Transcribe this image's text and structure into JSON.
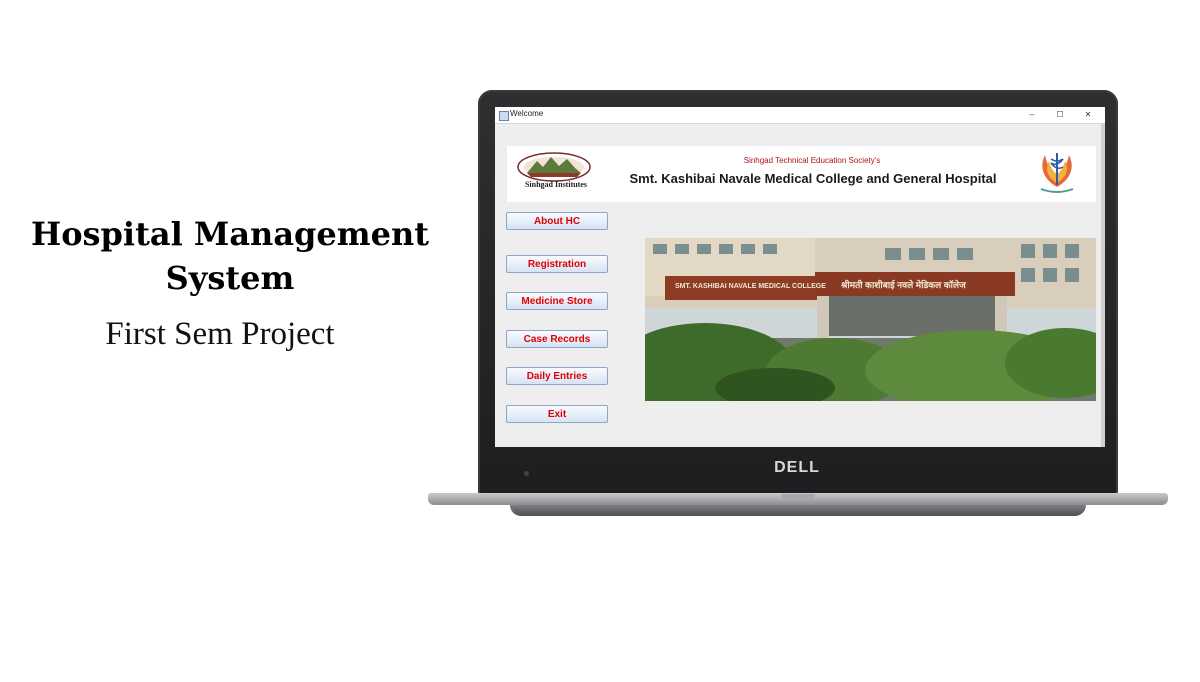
{
  "slide": {
    "title_line1": "Hospital Management",
    "title_line2": "System",
    "subtitle": "First Sem Project"
  },
  "laptop": {
    "brand": "DELL"
  },
  "window": {
    "title": "Welcome",
    "controls": {
      "minimize": "–",
      "maximize": "☐",
      "close": "✕"
    }
  },
  "banner": {
    "institute_name": "Sinhgad Institutes",
    "society": "Sinhgad Technical Education Society's",
    "college": "Smt. Kashibai Navale Medical College and General Hospital"
  },
  "menu": {
    "about": "About HC",
    "registration": "Registration",
    "medicine_store": "Medicine Store",
    "case_records": "Case Records",
    "daily_entries": "Daily Entries",
    "exit": "Exit"
  },
  "photo": {
    "sign_english": "SMT. KASHIBAI NAVALE MEDICAL COLLEGE",
    "sign_marathi": "श्रीमती काशीबाई नवले मेडिकल कॉलेज"
  },
  "colors": {
    "button_text": "#e00000",
    "society_text": "#b3121a",
    "laptop_bezel": "#2a2a2c"
  }
}
